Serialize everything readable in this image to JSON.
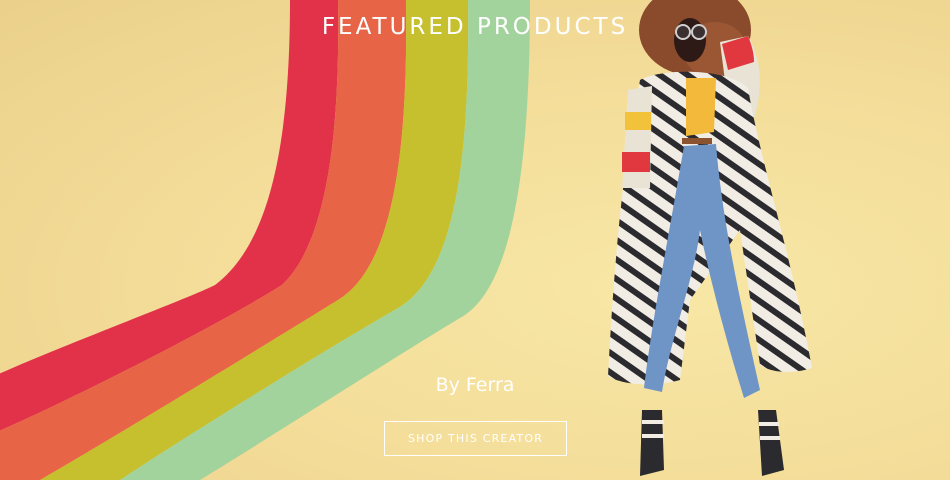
{
  "banner": {
    "title": "FEATURED PRODUCTS",
    "byline": "By Ferra",
    "cta_label": "SHOP THIS CREATOR"
  },
  "colors": {
    "background": "#f3dc98",
    "stripe_red": "#e2324a",
    "stripe_orange": "#e76446",
    "stripe_olive": "#c6bf2e",
    "stripe_green": "#a3d39c",
    "text": "#ffffff"
  },
  "illustration": {
    "subject": "fashion-model-avatar"
  }
}
